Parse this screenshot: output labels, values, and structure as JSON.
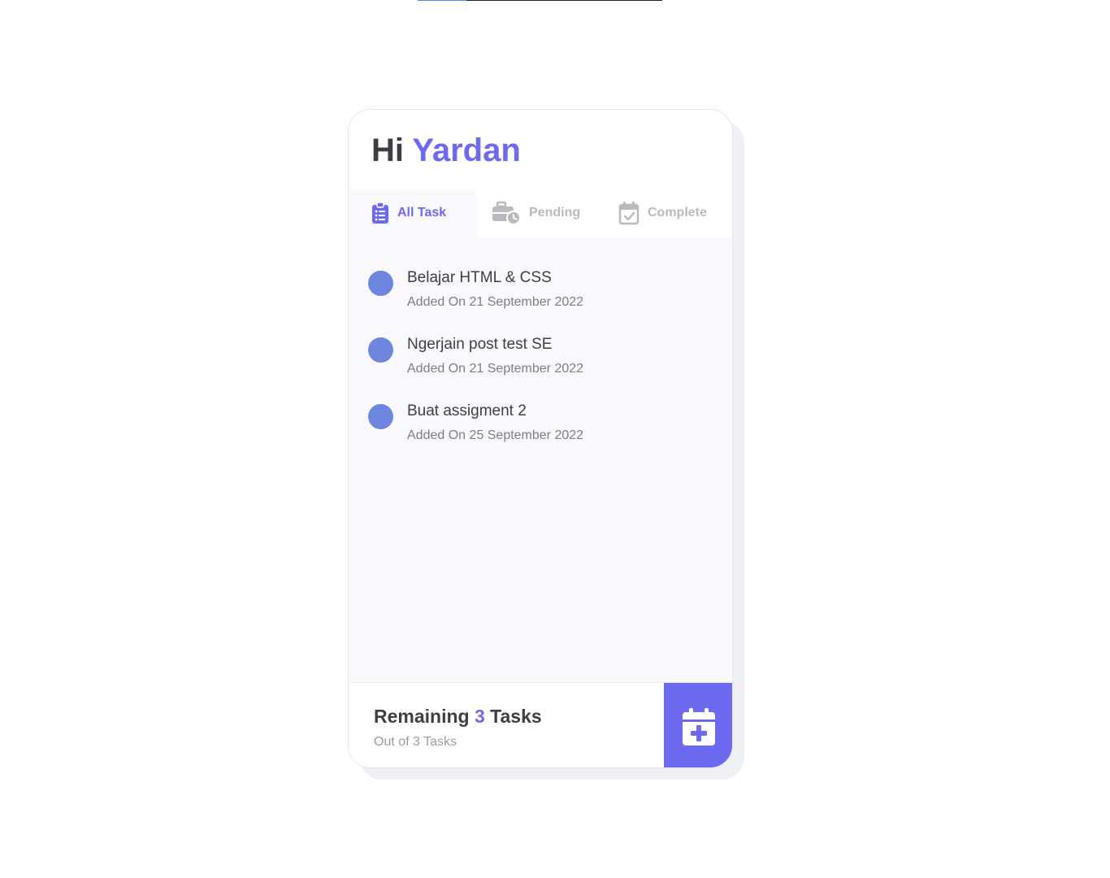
{
  "progress_bar": {
    "fraction": 0.2
  },
  "header": {
    "greeting": "Hi",
    "user_name": "Yardan"
  },
  "tabs": [
    {
      "label": "All Task",
      "icon": "clipboard-list-icon",
      "active": true
    },
    {
      "label": "Pending",
      "icon": "briefcase-clock-icon",
      "active": false
    },
    {
      "label": "Complete",
      "icon": "calendar-check-icon",
      "active": false
    }
  ],
  "tasks": [
    {
      "title": "Belajar HTML & CSS",
      "added": "Added On 21 September 2022"
    },
    {
      "title": "Ngerjain post test SE",
      "added": "Added On 21 September 2022"
    },
    {
      "title": "Buat assigment 2",
      "added": "Added On 25 September 2022"
    }
  ],
  "footer": {
    "remaining_prefix": "Remaining",
    "remaining_count": "3",
    "remaining_suffix": "Tasks",
    "out_of": "Out of 3 Tasks",
    "add_icon": "calendar-plus-icon"
  },
  "colors": {
    "accent": "#6d6af0",
    "task_dot": "#6e86dd",
    "text_dark": "#3d3f45",
    "inactive": "#b9b9be"
  }
}
